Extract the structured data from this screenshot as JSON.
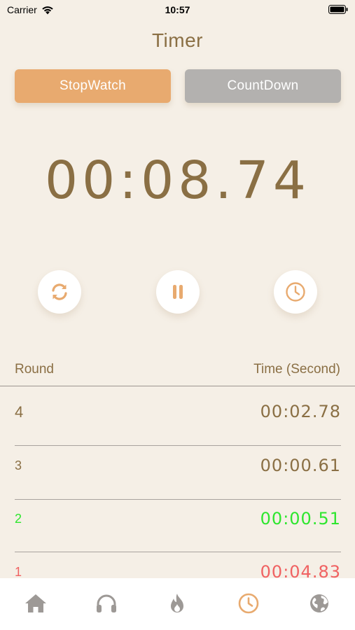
{
  "status_bar": {
    "carrier": "Carrier",
    "time": "10:57"
  },
  "title": "Timer",
  "modes": {
    "stopwatch": "StopWatch",
    "countdown": "CountDown",
    "active": "stopwatch"
  },
  "display_time": "00:08.74",
  "controls": {
    "reset_icon": "refresh-icon",
    "pause_icon": "pause-icon",
    "lap_icon": "clock-icon"
  },
  "table": {
    "header_round": "Round",
    "header_time": "Time (Second)",
    "rows": [
      {
        "round": "4",
        "time": "00:02.78",
        "color": "#8a6f44"
      },
      {
        "round": "3",
        "time": "00:00.61",
        "color": "#8a6f44"
      },
      {
        "round": "2",
        "time": "00:00.51",
        "color": "#2ee62e"
      },
      {
        "round": "1",
        "time": "00:04.83",
        "color": "#f06262"
      }
    ]
  },
  "tabs": [
    {
      "icon": "home-icon",
      "active": false
    },
    {
      "icon": "headphones-icon",
      "active": false
    },
    {
      "icon": "flame-icon",
      "active": false
    },
    {
      "icon": "clock-icon",
      "active": true
    },
    {
      "icon": "globe-icon",
      "active": false
    }
  ],
  "colors": {
    "accent": "#e8aa6f",
    "text": "#8a6f44",
    "inactive": "#b3b1af",
    "background": "#f5efe6",
    "fastest": "#2ee62e",
    "slowest": "#f06262"
  }
}
